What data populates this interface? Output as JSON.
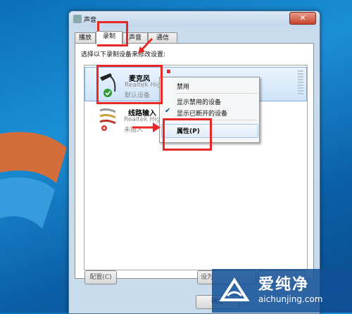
{
  "window": {
    "title": "声音",
    "close_glyph": "✕"
  },
  "tabs": [
    "播放",
    "录制",
    "声音",
    "通信"
  ],
  "active_tab": "录制",
  "instruction": "选择以下录制设备来修改设置:",
  "devices": [
    {
      "name": "麦克风",
      "driver": "Realtek High",
      "status": "默认设备",
      "icon": "microphone-icon",
      "selected": true
    },
    {
      "name": "线路输入",
      "driver": "Realtek High",
      "status": "未插入",
      "icon": "line-in-icon",
      "selected": false
    }
  ],
  "buttons": {
    "configure": "配置(C)",
    "set_default": "设为",
    "ok": "确定"
  },
  "context_menu": {
    "items": [
      {
        "label": "禁用",
        "checked": false
      },
      {
        "label": "显示禁用的设备",
        "checked": false
      },
      {
        "label": "显示已断开的设备",
        "checked": true
      },
      {
        "label": "属性(P)",
        "checked": false,
        "highlighted": true
      }
    ]
  },
  "watermark": {
    "cn": "爱纯净",
    "en": "aichunjing.com"
  },
  "colors": {
    "annotation_red": "#e82727",
    "desktop_blue": "#1c8fd6",
    "selection_blue": "#cfe4fa"
  }
}
